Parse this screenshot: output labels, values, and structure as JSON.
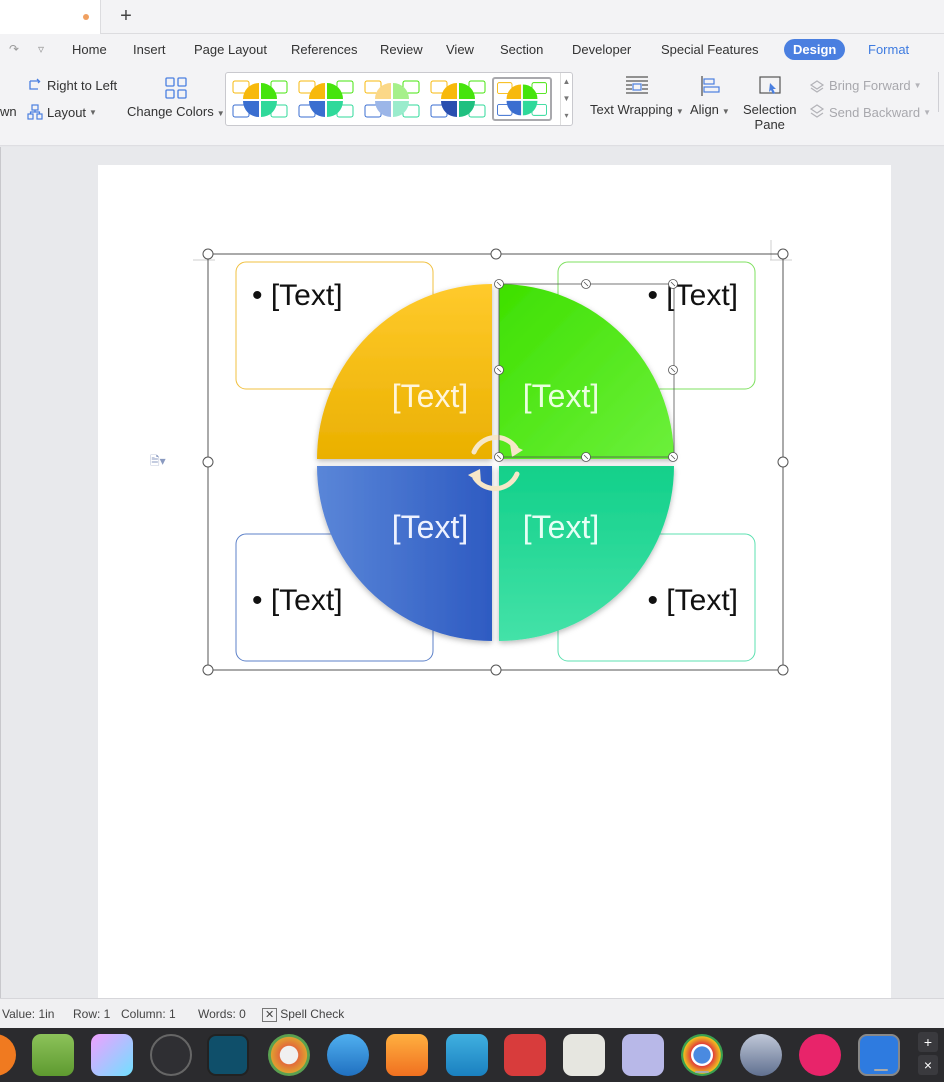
{
  "tabbar": {
    "new_tab_glyph": "+"
  },
  "menubar": {
    "undo_icon": "redo-icon",
    "quick_icon": "customize-icon",
    "items": [
      "Home",
      "Insert",
      "Page Layout",
      "References",
      "Review",
      "View",
      "Section",
      "Developer",
      "Special Features",
      "Design",
      "Format"
    ],
    "active": "Design"
  },
  "ribbon": {
    "partial_left": "wn",
    "right_to_left": "Right to Left",
    "layout": "Layout",
    "change_colors": "Change Colors",
    "text_wrapping": "Text Wrapping",
    "align": "Align",
    "selection_pane_1": "Selection",
    "selection_pane_2": "Pane",
    "bring_forward": "Bring Forward",
    "send_backward": "Send Backward"
  },
  "colors": {
    "yellow": "#f7b90c",
    "green": "#46e40c",
    "blue": "#3a6ed0",
    "teal": "#2fd99a",
    "accent": "#4a7fe0"
  },
  "smartart": {
    "quadrant_text": [
      "[Text]",
      "[Text]",
      "[Text]",
      "[Text]"
    ],
    "bullet_text": [
      "• [Text]",
      "• [Text]",
      "• [Text]",
      "• [Text]"
    ]
  },
  "statusbar": {
    "value": "Value: 1in",
    "row": "Row: 1",
    "column": "Column: 1",
    "words": "Words: 0",
    "spell_check": "Spell Check"
  },
  "dock": {
    "apps": [
      "app-icon",
      "files-icon",
      "paint-icon",
      "obs-icon",
      "terminal-icon",
      "chromium-icon",
      "whale-icon",
      "firefox-icon",
      "shutter-icon",
      "gimp-icon",
      "inkscape-icon",
      "document-viewer-icon",
      "chrome-icon",
      "video-icon",
      "flickr-icon",
      "wps-icon"
    ],
    "side_plus": "+",
    "side_close": "×"
  }
}
